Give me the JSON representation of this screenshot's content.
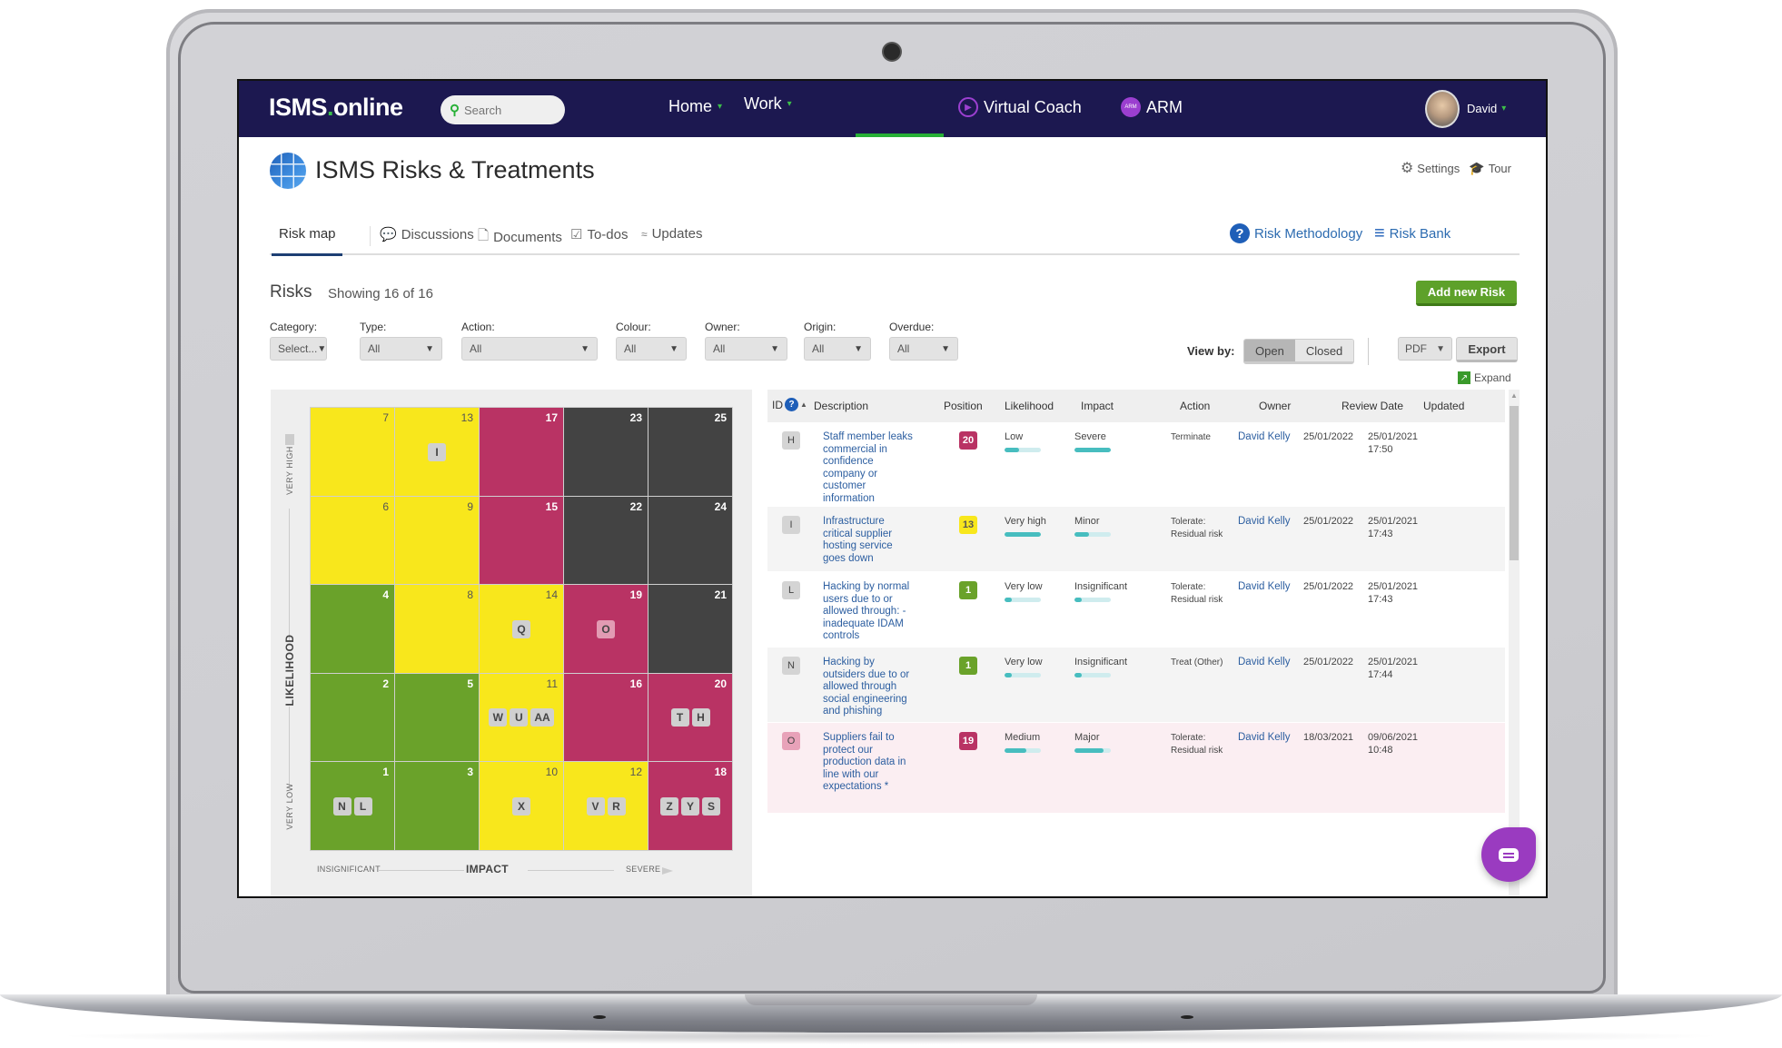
{
  "app": {
    "logo_main": "ISMS",
    "logo_dot": ".",
    "logo_suffix": "online",
    "search_placeholder": "Search",
    "nav": [
      {
        "label": "Home",
        "has_caret": true
      },
      {
        "label": "Work",
        "has_caret": true,
        "active": true
      },
      {
        "label": "Virtual Coach",
        "icon": "play-circle-icon"
      },
      {
        "label": "ARM",
        "icon": "arm-badge-icon",
        "badge": "ARM"
      }
    ],
    "user": {
      "name": "David"
    },
    "caret": "▾"
  },
  "page": {
    "title": "ISMS Risks & Treatments",
    "settings_label": "Settings",
    "tour_label": "Tour",
    "tabs": [
      {
        "label": "Risk map",
        "active": true
      },
      {
        "label": "Discussions",
        "icon": "chat-bubbles-icon"
      },
      {
        "label": "Documents",
        "icon": "document-icon"
      },
      {
        "label": "To-dos",
        "icon": "clipboard-check-icon"
      },
      {
        "label": "Updates",
        "icon": "wifi-icon"
      }
    ],
    "right_tabs": [
      {
        "label": "Risk Methodology",
        "icon": "question-circle-icon"
      },
      {
        "label": "Risk Bank",
        "icon": "layers-icon"
      }
    ]
  },
  "risks": {
    "title": "Risks",
    "count_text": "Showing 16 of 16",
    "add_button": "Add new Risk",
    "filters": [
      {
        "label": "Category:",
        "value": "Select..."
      },
      {
        "label": "Type:",
        "value": "All"
      },
      {
        "label": "Action:",
        "value": "All"
      },
      {
        "label": "Colour:",
        "value": "All"
      },
      {
        "label": "Owner:",
        "value": "All"
      },
      {
        "label": "Origin:",
        "value": "All"
      },
      {
        "label": "Overdue:",
        "value": "All"
      }
    ],
    "view_by_label": "View by:",
    "view_by_options": [
      "Open",
      "Closed"
    ],
    "view_by_selected": "Open",
    "export_format": "PDF",
    "export_button": "Export",
    "expand_label": "Expand"
  },
  "risk_map": {
    "y_axis": {
      "title": "LIKELIHOOD",
      "high": "VERY HIGH",
      "low": "VERY LOW"
    },
    "x_axis": {
      "title": "IMPACT",
      "low": "INSIGNIFICANT",
      "high": "SEVERE"
    },
    "colors": {
      "green": "#6aa22a",
      "yellow": "#f8e71c",
      "red": "#b93364",
      "black": "#434343"
    },
    "rows": [
      [
        {
          "n": "7",
          "c": "yellow",
          "ids": []
        },
        {
          "n": "13",
          "c": "yellow",
          "ids": [
            "I"
          ]
        },
        {
          "n": "17",
          "c": "red",
          "ids": []
        },
        {
          "n": "23",
          "c": "black",
          "ids": []
        },
        {
          "n": "25",
          "c": "black",
          "ids": []
        }
      ],
      [
        {
          "n": "6",
          "c": "yellow",
          "ids": []
        },
        {
          "n": "9",
          "c": "yellow",
          "ids": []
        },
        {
          "n": "15",
          "c": "red",
          "ids": []
        },
        {
          "n": "22",
          "c": "black",
          "ids": []
        },
        {
          "n": "24",
          "c": "black",
          "ids": []
        }
      ],
      [
        {
          "n": "4",
          "c": "green",
          "ids": []
        },
        {
          "n": "8",
          "c": "yellow",
          "ids": []
        },
        {
          "n": "14",
          "c": "yellow",
          "ids": [
            "Q"
          ]
        },
        {
          "n": "19",
          "c": "red",
          "ids": [
            "O"
          ],
          "pink": true
        },
        {
          "n": "21",
          "c": "black",
          "ids": []
        }
      ],
      [
        {
          "n": "2",
          "c": "green",
          "ids": []
        },
        {
          "n": "5",
          "c": "green",
          "ids": []
        },
        {
          "n": "11",
          "c": "yellow",
          "ids": [
            "W",
            "U",
            "AA"
          ]
        },
        {
          "n": "16",
          "c": "red",
          "ids": []
        },
        {
          "n": "20",
          "c": "red",
          "ids": [
            "T",
            "H"
          ]
        }
      ],
      [
        {
          "n": "1",
          "c": "green",
          "ids": [
            "N",
            "L"
          ]
        },
        {
          "n": "3",
          "c": "green",
          "ids": []
        },
        {
          "n": "10",
          "c": "yellow",
          "ids": [
            "X"
          ]
        },
        {
          "n": "12",
          "c": "yellow",
          "ids": [
            "V",
            "R"
          ]
        },
        {
          "n": "18",
          "c": "red",
          "ids": [
            "Z",
            "Y",
            "S"
          ]
        }
      ]
    ]
  },
  "table": {
    "columns": {
      "id": "ID",
      "description": "Description",
      "position": "Position",
      "likelihood": "Likelihood",
      "impact": "Impact",
      "action": "Action",
      "owner": "Owner",
      "review_date": "Review Date",
      "updated": "Updated"
    },
    "rows": [
      {
        "id": "H",
        "description": "Staff member leaks commercial in confidence company or customer information",
        "position": "20",
        "position_color": "red",
        "likelihood": "Low",
        "likelihood_level": 0.4,
        "impact": "Severe",
        "impact_level": 1.0,
        "action": "Terminate",
        "owner": "David Kelly",
        "review_date": "25/01/2022",
        "updated_date": "25/01/2021",
        "updated_time": "17:50",
        "bg": "white"
      },
      {
        "id": "I",
        "description": "Infrastructure critical supplier hosting service goes down",
        "position": "13",
        "position_color": "yellow",
        "likelihood": "Very high",
        "likelihood_level": 1.0,
        "impact": "Minor",
        "impact_level": 0.4,
        "action": "Tolerate: Residual risk",
        "owner": "David Kelly",
        "review_date": "25/01/2022",
        "updated_date": "25/01/2021",
        "updated_time": "17:43",
        "bg": "alt"
      },
      {
        "id": "L",
        "description": "Hacking by normal users due to or allowed through: - inadequate IDAM controls",
        "position": "1",
        "position_color": "green",
        "likelihood": "Very low",
        "likelihood_level": 0.2,
        "impact": "Insignificant",
        "impact_level": 0.2,
        "action": "Tolerate: Residual risk",
        "owner": "David Kelly",
        "review_date": "25/01/2022",
        "updated_date": "25/01/2021",
        "updated_time": "17:43",
        "bg": "white"
      },
      {
        "id": "N",
        "description": "Hacking by outsiders due to or allowed through social engineering and phishing",
        "position": "1",
        "position_color": "green",
        "likelihood": "Very low",
        "likelihood_level": 0.2,
        "impact": "Insignificant",
        "impact_level": 0.2,
        "action": "Treat (Other)",
        "owner": "David Kelly",
        "review_date": "25/01/2022",
        "updated_date": "25/01/2021",
        "updated_time": "17:44",
        "bg": "alt"
      },
      {
        "id": "O",
        "description": "Suppliers fail to protect our production data in line with our expectations *",
        "position": "19",
        "position_color": "red",
        "likelihood": "Medium",
        "likelihood_level": 0.6,
        "impact": "Major",
        "impact_level": 0.8,
        "action": "Tolerate: Residual risk",
        "owner": "David Kelly",
        "review_date": "18/03/2021",
        "updated_date": "09/06/2021",
        "updated_time": "10:48",
        "bg": "pink"
      }
    ]
  }
}
